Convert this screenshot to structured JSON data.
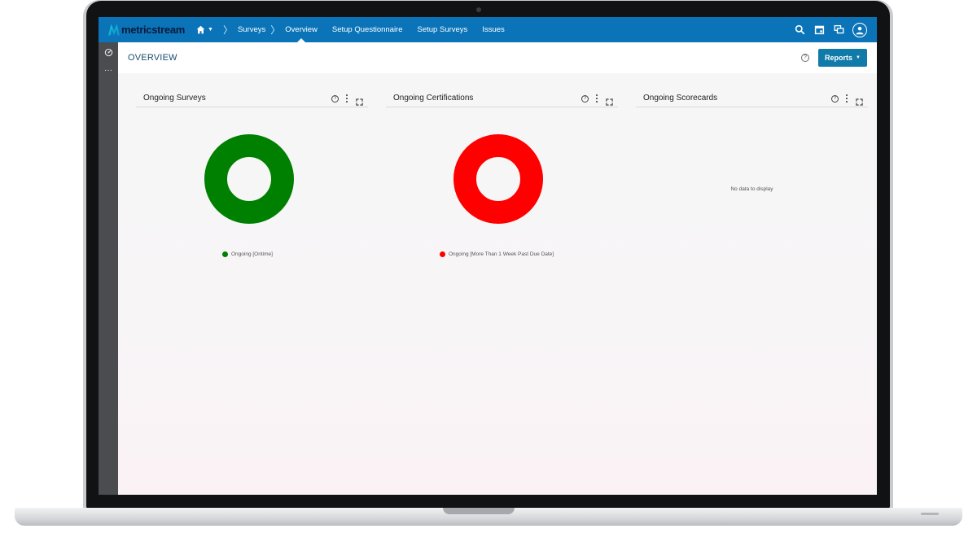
{
  "app": {
    "logo_text": "metricstream"
  },
  "nav": {
    "items": [
      {
        "label": "Surveys"
      },
      {
        "label": "Overview",
        "active": true
      },
      {
        "label": "Setup Questionnaire"
      },
      {
        "label": "Setup Surveys"
      },
      {
        "label": "Issues"
      }
    ],
    "home_icon": "home-icon",
    "right_icons": [
      "search-icon",
      "calendar-icon",
      "messages-icon",
      "user-avatar-icon"
    ]
  },
  "sidebar": {
    "icons": [
      "dashboard-icon",
      "more-icon"
    ]
  },
  "page": {
    "title": "OVERVIEW",
    "help_icon": "help-icon",
    "reports_label": "Reports"
  },
  "widgets": [
    {
      "title": "Ongoing Surveys",
      "chart_data": {
        "type": "pie",
        "subtype": "donut",
        "slices": [
          {
            "label": "Ongoing [Ontime]",
            "value": 100,
            "color": "#008000"
          }
        ]
      },
      "legend": "Ongoing [Ontime]"
    },
    {
      "title": "Ongoing Certifications",
      "chart_data": {
        "type": "pie",
        "subtype": "donut",
        "slices": [
          {
            "label": "Ongoing [More Than 1 Week Past Due Date]",
            "value": 100,
            "color": "#ff0000"
          }
        ]
      },
      "legend": "Ongoing [More Than 1 Week Past Due Date]"
    },
    {
      "title": "Ongoing Scorecards",
      "empty_text": "No data to display"
    }
  ],
  "colors": {
    "topbar": "#0b74b8",
    "reports_button": "#107aa8",
    "ontime_green": "#008000",
    "overdue_red": "#ff0000"
  }
}
